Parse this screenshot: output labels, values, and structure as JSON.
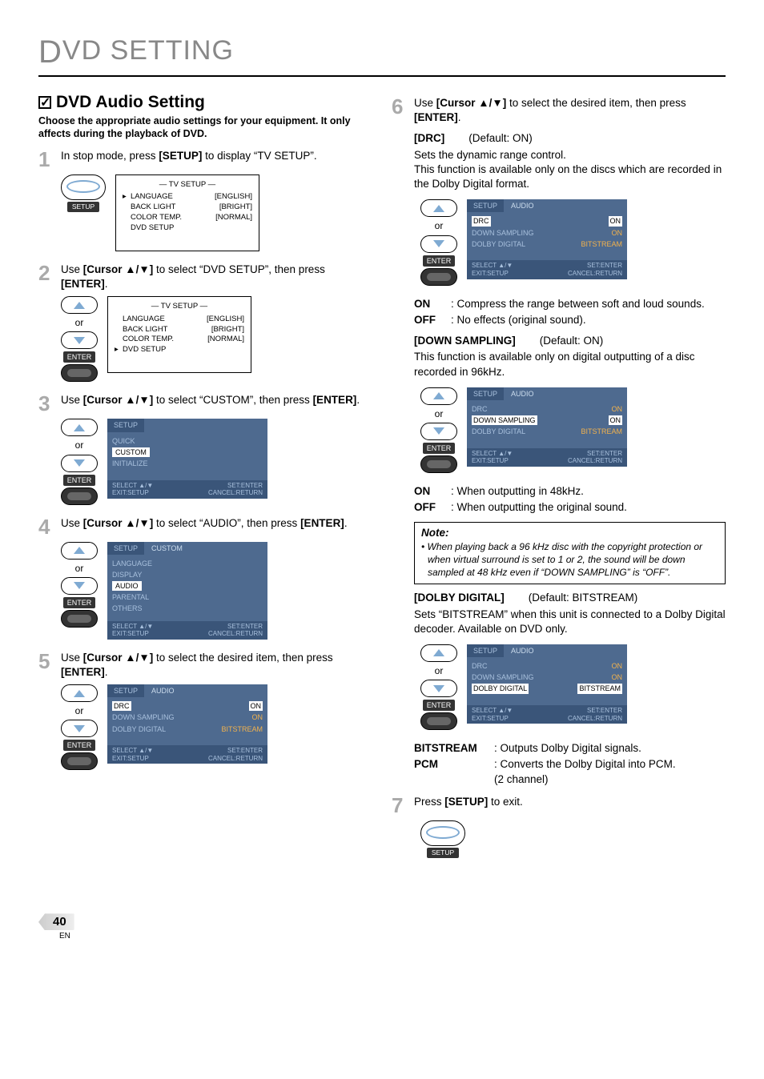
{
  "header": {
    "letter": "D",
    "rest": "VD  SETTING"
  },
  "section": {
    "title": "DVD Audio Setting",
    "subtitle": "Choose the appropriate audio settings for your equipment. It only affects during the playback of DVD."
  },
  "labels": {
    "or": "or",
    "enter": "ENTER",
    "setup": "SETUP",
    "select_hint_l1": "SELECT ▲/▼",
    "select_hint_l2": "EXIT:SETUP",
    "select_hint_r1": "SET:ENTER",
    "select_hint_r2": "CANCEL:RETURN"
  },
  "tv_setup_screen": {
    "title": "—  TV SETUP  —",
    "rows": [
      {
        "label": "LANGUAGE",
        "value": "[ENGLISH]"
      },
      {
        "label": "BACK LIGHT",
        "value": "[BRIGHT]"
      },
      {
        "label": "COLOR TEMP.",
        "value": "[NORMAL]"
      },
      {
        "label": "DVD SETUP",
        "value": ""
      }
    ]
  },
  "steps": {
    "s1": {
      "num": "1",
      "text_pre": "In stop mode, press ",
      "bold": "[SETUP]",
      "text_post": " to display “TV SETUP”.",
      "pointer_row": 0
    },
    "s2": {
      "num": "2",
      "text_pre": "Use ",
      "bold": "[Cursor ▲/▼]",
      "text_mid": " to select “DVD SETUP”, then press ",
      "bold2": "[ENTER]",
      "text_post": ".",
      "pointer_row": 3
    },
    "s3": {
      "num": "3",
      "text_pre": "Use ",
      "bold": "[Cursor ▲/▼]",
      "text_mid": " to select “CUSTOM”, then press ",
      "bold2": "[ENTER]",
      "text_post": "."
    },
    "s4": {
      "num": "4",
      "text_pre": "Use ",
      "bold": "[Cursor ▲/▼]",
      "text_mid": " to select “AUDIO”, then press ",
      "bold2": "[ENTER]",
      "text_post": "."
    },
    "s5": {
      "num": "5",
      "text_pre": "Use ",
      "bold": "[Cursor ▲/▼]",
      "text_mid": " to select the desired item, then press ",
      "bold2": "[ENTER]",
      "text_post": "."
    },
    "s6": {
      "num": "6",
      "text_pre": "Use ",
      "bold": "[Cursor ▲/▼]",
      "text_mid": " to select the desired item, then press ",
      "bold2": "[ENTER]",
      "text_post": "."
    },
    "s7": {
      "num": "7",
      "text_pre": "Press ",
      "bold": "[SETUP]",
      "text_post": " to exit."
    }
  },
  "osd": {
    "setup_tab": "SETUP",
    "custom_tab": "CUSTOM",
    "audio_tab": "AUDIO",
    "setup_menu": {
      "items": [
        "QUICK",
        "CUSTOM",
        "INITIALIZE"
      ],
      "selected": 1
    },
    "custom_menu": {
      "items": [
        "LANGUAGE",
        "DISPLAY",
        "AUDIO",
        "PARENTAL",
        "OTHERS"
      ],
      "selected": 2
    },
    "audio_rows": [
      {
        "label": "DRC",
        "value": "ON"
      },
      {
        "label": "DOWN SAMPLING",
        "value": "ON"
      },
      {
        "label": "DOLBY DIGITAL",
        "value": "BITSTREAM"
      }
    ]
  },
  "drc": {
    "heading": "[DRC]",
    "default": "(Default: ON)",
    "desc": "Sets the dynamic range control.",
    "desc2": "This function is available only on the discs which are recorded in the Dolby Digital format.",
    "on": {
      "k": "ON",
      "v": ": Compress the range between soft and loud sounds."
    },
    "off": {
      "k": "OFF",
      "v": ": No effects (original sound)."
    }
  },
  "down": {
    "heading": "[DOWN SAMPLING]",
    "default": "(Default: ON)",
    "desc": "This function is available only on digital outputting of a disc recorded in 96kHz.",
    "on": {
      "k": "ON",
      "v": ": When outputting in 48kHz."
    },
    "off": {
      "k": "OFF",
      "v": ": When outputting the original sound."
    },
    "note_title": "Note:",
    "note_body": "When playing back a 96 kHz disc with the copyright protection or when virtual surround is set to 1 or 2, the sound will be down sampled at 48 kHz even if “DOWN SAMPLING” is “OFF”."
  },
  "dolby": {
    "heading": "[DOLBY DIGITAL]",
    "default": "(Default: BITSTREAM)",
    "desc": "Sets “BITSTREAM” when this unit is connected to a Dolby Digital decoder. Available on DVD only.",
    "bitstream": {
      "k": "BITSTREAM",
      "v": ": Outputs Dolby Digital signals."
    },
    "pcm": {
      "k": "PCM",
      "v1": ": Converts the Dolby Digital into PCM.",
      "v2": "  (2 channel)"
    }
  },
  "footer": {
    "page": "40",
    "lang": "EN"
  }
}
